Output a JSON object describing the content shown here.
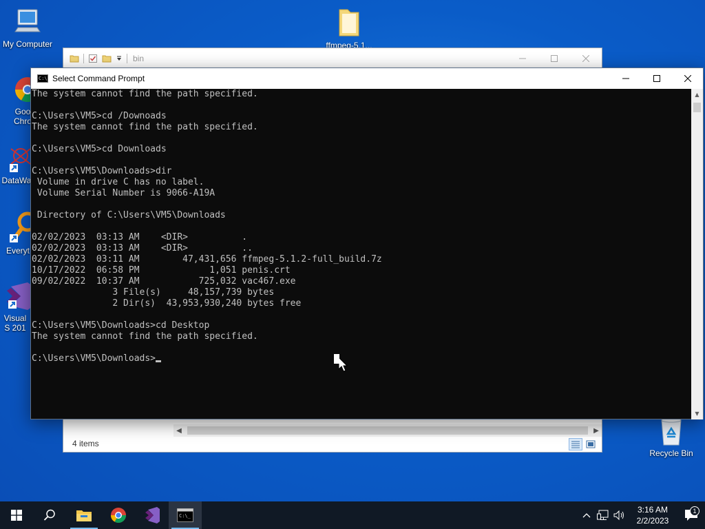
{
  "desktop": {
    "icons": [
      {
        "label": "My Computer"
      },
      {
        "label": "ffmpeg-5.1..."
      },
      {
        "label": "Goo Chro"
      },
      {
        "label": "DataWa"
      },
      {
        "label": "Everyt"
      },
      {
        "label": "Visual S 201"
      },
      {
        "label": "Recycle Bin"
      }
    ]
  },
  "explorer": {
    "title": "bin",
    "status": "4 items"
  },
  "cmd": {
    "title": "Select Command Prompt",
    "lines": [
      "The system cannot find the path specified.",
      "",
      "C:\\Users\\VM5>cd /Downoads",
      "The system cannot find the path specified.",
      "",
      "C:\\Users\\VM5>cd Downloads",
      "",
      "C:\\Users\\VM5\\Downloads>dir",
      " Volume in drive C has no label.",
      " Volume Serial Number is 9066-A19A",
      "",
      " Directory of C:\\Users\\VM5\\Downloads",
      "",
      "02/02/2023  03:13 AM    <DIR>          .",
      "02/02/2023  03:13 AM    <DIR>          ..",
      "02/02/2023  03:11 AM        47,431,656 ffmpeg-5.1.2-full_build.7z",
      "10/17/2022  06:58 PM             1,051 penis.crt",
      "09/02/2022  10:37 AM           725,032 vac467.exe",
      "               3 File(s)     48,157,739 bytes",
      "               2 Dir(s)  43,953,930,240 bytes free",
      "",
      "C:\\Users\\VM5\\Downloads>cd Desktop",
      "The system cannot find the path specified.",
      ""
    ],
    "prompt": "C:\\Users\\VM5\\Downloads>"
  },
  "taskbar": {
    "time": "3:16 AM",
    "date": "2/2/2023",
    "notification_count": "1"
  },
  "colors": {
    "accent": "#76b9ed",
    "console_bg": "#0c0c0c",
    "console_fg": "#c0c0c0",
    "taskbar_bg": "#101925"
  }
}
